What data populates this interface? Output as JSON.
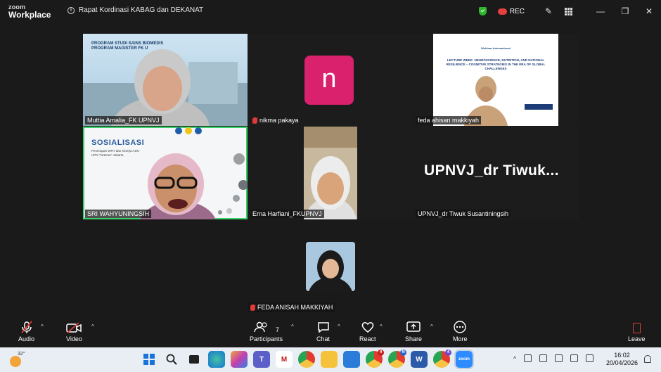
{
  "app": {
    "logo_line1": "zoom",
    "logo_line2": "Workplace"
  },
  "meeting": {
    "title": "Rapat Kordinasi KABAG dan DEKANAT"
  },
  "header": {
    "rec_label": "REC"
  },
  "participants_tiles": [
    {
      "name": "Muttia Amalia_FK UPNVJ",
      "slide_line1": "PROGRAM STUDI SAINS BIOMEDIS",
      "slide_line2": "PROGRAM MAGISTER FK U"
    },
    {
      "name": "nikma pakaya",
      "avatar_letter": "n",
      "avatar_color": "#d9216d"
    },
    {
      "name": "feda ahisan makkiyah",
      "slide_title": "LECTURE WEEK: NEUROSCIENCE, NUTRITION, AND NATIONAL RESILIENCE – COGNITIVE STRATEGIES IN THE ERA OF GLOBAL CHALLENGES",
      "slide_sub": "Webinar Internasional"
    },
    {
      "name": "SRI WAHYUNINGSIH",
      "slide_title": "SOSIALISASI",
      "slide_line1": "Penerapan WFH dan Kinerja ASN",
      "slide_line2": "UPN \"Veteran\" Jakarta"
    },
    {
      "name": "Erna Harfiani_FKUPNVJ"
    },
    {
      "name": "UPNVJ_dr Tiwuk Susantiningsih",
      "display_text": "UPNVJ_dr Tiwuk..."
    },
    {
      "name": "FEDA ANISAH MAKKIYAH"
    }
  ],
  "toolbar": {
    "audio": "Audio",
    "video": "Video",
    "participants": "Participants",
    "participants_count": "7",
    "chat": "Chat",
    "react": "React",
    "share": "Share",
    "more": "More",
    "leave": "Leave"
  },
  "taskbar": {
    "temperature": "32°",
    "time": "16:02",
    "date": "20/04/2026",
    "badges": [
      "4",
      "N",
      "4"
    ]
  },
  "colors": {
    "accent_green": "#3ad26a",
    "rec_red": "#e84040",
    "mute_red": "#e03b3b"
  }
}
